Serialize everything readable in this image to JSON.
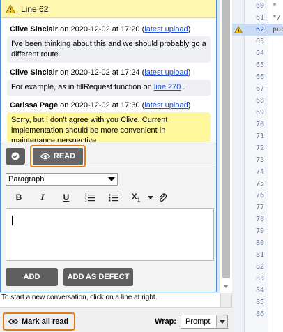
{
  "conversation": {
    "header": "Line 62",
    "messages": [
      {
        "author": "Clive Sinclair",
        "on": "on",
        "date": "2020-12-02 at 17:20",
        "link": "latest upload",
        "text": "I've been thinking about this and we should probably go a different route."
      },
      {
        "author": "Clive Sinclair",
        "on": "on",
        "date": "2020-12-02 at 17:24",
        "link": "latest upload",
        "text_before": "For example, as in fillRequest function on ",
        "text_link": "line 270",
        "text_after": " ."
      },
      {
        "author": "Carissa Page",
        "on": "on",
        "date": "2020-12-02 at 17:30",
        "link": "latest upload",
        "text": "Sorry, but I don't agree with you Clive. Current implementation should be more convenient in maintenance perspective."
      }
    ],
    "read_label": "READ"
  },
  "editor": {
    "paragraph_value": "Paragraph",
    "toolbar": {
      "bold": "B",
      "italic": "I",
      "underline": "U",
      "subscript": "X",
      "subscript_sub": "1"
    },
    "add_label": "ADD",
    "add_defect_label": "ADD AS DEFECT"
  },
  "hint": "To start a new conversation, click on a line at right.",
  "bottom": {
    "mark_all_label": "Mark all read",
    "wrap_label": "Wrap:",
    "wrap_value": "Prompt"
  },
  "code": {
    "lines": [
      {
        "num": "60",
        "code": "*"
      },
      {
        "num": "61",
        "code": "*/"
      },
      {
        "num": "62",
        "code": "pub"
      },
      {
        "num": "63",
        "code": ""
      },
      {
        "num": "64",
        "code": ""
      },
      {
        "num": "65",
        "code": ""
      },
      {
        "num": "66",
        "code": ""
      },
      {
        "num": "67",
        "code": ""
      },
      {
        "num": "68",
        "code": ""
      },
      {
        "num": "69",
        "code": ""
      },
      {
        "num": "70",
        "code": ""
      },
      {
        "num": "71",
        "code": ""
      },
      {
        "num": "72",
        "code": ""
      },
      {
        "num": "73",
        "code": ""
      },
      {
        "num": "74",
        "code": ""
      },
      {
        "num": "75",
        "code": ""
      },
      {
        "num": "76",
        "code": ""
      },
      {
        "num": "77",
        "code": ""
      },
      {
        "num": "78",
        "code": ""
      },
      {
        "num": "79",
        "code": ""
      },
      {
        "num": "80",
        "code": ""
      },
      {
        "num": "81",
        "code": ""
      },
      {
        "num": "82",
        "code": ""
      },
      {
        "num": "83",
        "code": ""
      },
      {
        "num": "84",
        "code": ""
      },
      {
        "num": "85",
        "code": ""
      },
      {
        "num": "86",
        "code": ""
      }
    ]
  },
  "colors": {
    "accent": "#4a90d9",
    "highlight_orange": "#e07e1a",
    "warning_yellow": "#fff7b0",
    "button_dark": "#5e5e5e"
  }
}
